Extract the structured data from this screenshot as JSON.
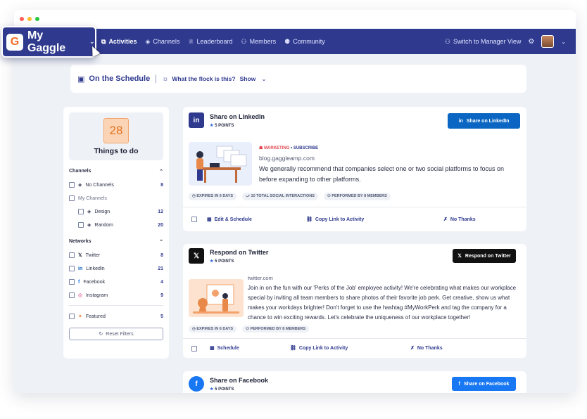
{
  "brand": {
    "name": "My Gaggle",
    "logo_letter": "G"
  },
  "nav": {
    "items": [
      {
        "label": "Activities",
        "icon": "activities-icon",
        "glyph": "⧉",
        "active": true
      },
      {
        "label": "Channels",
        "icon": "channels-icon",
        "glyph": "◈",
        "active": false
      },
      {
        "label": "Leaderboard",
        "icon": "trophy-icon",
        "glyph": "♕",
        "active": false
      },
      {
        "label": "Members",
        "icon": "members-icon",
        "glyph": "⚇",
        "active": false
      },
      {
        "label": "Community",
        "icon": "community-icon",
        "glyph": "⚉",
        "active": false
      }
    ],
    "switch_label": "Switch to Manager View"
  },
  "schedule_bar": {
    "title": "On the Schedule",
    "flock_text": "What the flock is this?",
    "show_label": "Show"
  },
  "sidebar": {
    "todo_count": "28",
    "todo_label": "Things to do",
    "channels_heading": "Channels",
    "channels": [
      {
        "label": "No Channels",
        "count": "8"
      },
      {
        "label": "My Channels",
        "count": ""
      },
      {
        "label": "Design",
        "count": "12"
      },
      {
        "label": "Random",
        "count": "20"
      }
    ],
    "networks_heading": "Networks",
    "networks": [
      {
        "label": "Twitter",
        "count": "8"
      },
      {
        "label": "LinkedIn",
        "count": "21"
      },
      {
        "label": "Facebook",
        "count": "4"
      },
      {
        "label": "Instagram",
        "count": "9"
      }
    ],
    "featured": {
      "label": "Featured",
      "count": "5"
    },
    "reset_label": "Reset Filters"
  },
  "cards": [
    {
      "title": "Share on LinkedIn",
      "points": "5 POINTS",
      "cta": "Share on LinkedIn",
      "tag": "MARKETING",
      "tag_extra": "• SUBSCRIBE",
      "domain": "blog.gaggleamp.com",
      "body": "We generally recommend that companies select one or two social platforms to focus on before expanding to other platforms.",
      "meta": [
        "EXPIRES IN 6 DAYS",
        "10 TOTAL SOCIAL INTERACTIONS",
        "PERFORMED BY 8 MEMBERS"
      ],
      "actions": [
        "Edit & Schedule",
        "Copy Link to Activity",
        "No Thanks"
      ]
    },
    {
      "title": "Respond on Twitter",
      "points": "5 POINTS",
      "cta": "Respond on Twitter",
      "domain": "twitter.com",
      "body": "Join in on the fun with our 'Perks of the Job' employee activity! We're celebrating what makes our workplace special by inviting all team members to share photos of their favorite job perk. Get creative, show us what makes your workdays brighter! Don't forget to use the hashtag #MyWorkPerk and tag the company for a chance to win exciting rewards. Let's celebrate the uniqueness of our workplace together!",
      "meta": [
        "EXPIRES IN 6 DAYS",
        "PERFORMED BY 8 MEMBERS"
      ],
      "actions": [
        "Schedule",
        "Copy Link to Activity",
        "No Thanks"
      ]
    },
    {
      "title": "Share on Facebook",
      "points": "5 POINTS",
      "cta": "Share on Facebook"
    }
  ],
  "colors": {
    "nav": "#2f3a8f",
    "linkedin": "#0a66c2",
    "twitter": "#111111",
    "facebook": "#1877f2",
    "accent": "#f26a21"
  }
}
